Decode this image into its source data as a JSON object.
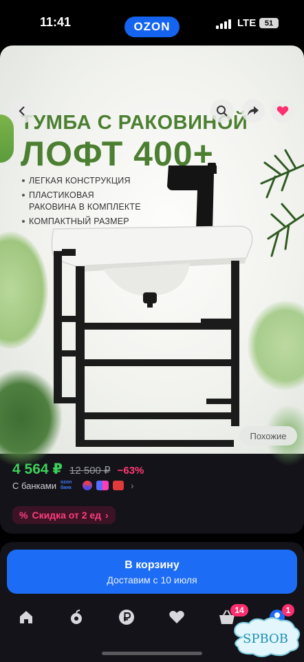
{
  "status_bar": {
    "time": "11:41",
    "app_badge": "OZON",
    "network": "LTE",
    "battery": "51"
  },
  "product_image": {
    "title_line1": "ТУМБА С РАКОВИНОЙ",
    "title_line2": "ЛОФТ 400+",
    "features": [
      "ЛЕГКАЯ КОНСТРУКЦИЯ",
      "ПЛАСТИКОВАЯ РАКОВИНА В КОМПЛЕКТЕ",
      "КОМПАКТНЫЙ РАЗМЕР"
    ],
    "similar_label": "Похожие"
  },
  "nav": {
    "back_icon": "chevron-left-icon",
    "search_icon": "search-icon",
    "share_icon": "share-icon",
    "favorite_icon": "heart-icon"
  },
  "pricing": {
    "price": "4 564 ₽",
    "old_price": "12 500 ₽",
    "discount": "−63%",
    "banks_label": "С банками",
    "ozon_bank_line1": "ozon",
    "ozon_bank_line2": "банк",
    "promo_label": "Скидка от 2 ед",
    "promo_icon": "%",
    "promo_chevron": "›"
  },
  "cart_button": {
    "label": "В корзину",
    "delivery": "Доставим с 10 июля"
  },
  "tab_bar": {
    "items": [
      {
        "name": "home",
        "icon": "home-icon"
      },
      {
        "name": "catalog",
        "icon": "fruit-icon"
      },
      {
        "name": "finance",
        "icon": "ruble-icon"
      },
      {
        "name": "favorites",
        "icon": "heart-icon"
      },
      {
        "name": "cart",
        "icon": "basket-icon",
        "badge": "14"
      },
      {
        "name": "profile",
        "icon": "profile-icon",
        "badge": "1"
      }
    ]
  },
  "watermark": "SPBOB",
  "colors": {
    "accent": "#1d6cf5",
    "price": "#3ecf5a",
    "discount": "#ff3a73",
    "title": "#4c7f31",
    "badge": "#ff2e6e"
  }
}
